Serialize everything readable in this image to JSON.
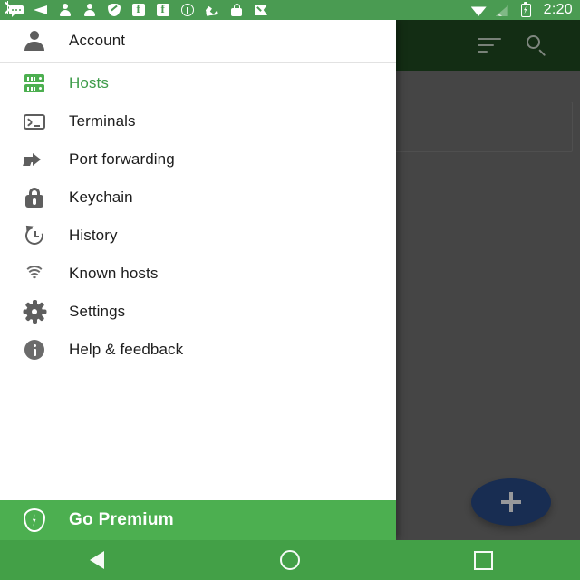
{
  "status_bar": {
    "time": "2:20",
    "left_icons": [
      {
        "name": "chat-bubble-icon",
        "glyph": "chat"
      },
      {
        "name": "send-arrow-icon",
        "glyph": "send"
      },
      {
        "name": "person-icon-1",
        "glyph": "person"
      },
      {
        "name": "person-icon-2",
        "glyph": "person"
      },
      {
        "name": "shield-icon",
        "glyph": "shield"
      },
      {
        "name": "facebook-icon-1",
        "glyph": "fb"
      },
      {
        "name": "facebook-icon-2",
        "glyph": "fb"
      },
      {
        "name": "info-circle-icon",
        "glyph": "info"
      },
      {
        "name": "satellite-icon",
        "glyph": "sat"
      },
      {
        "name": "padlock-icon",
        "glyph": "padlock"
      },
      {
        "name": "check-flag-icon",
        "glyph": "flag"
      }
    ],
    "right_icons": [
      {
        "name": "bluetooth-icon",
        "glyph": "bt"
      },
      {
        "name": "wifi-icon",
        "glyph": "wifi"
      },
      {
        "name": "cellular-signal-off-icon",
        "glyph": "signal"
      },
      {
        "name": "battery-charging-icon",
        "glyph": "batt"
      }
    ]
  },
  "app_bar": {
    "sort_icon": "sort-icon",
    "search_icon": "search-icon"
  },
  "drawer": {
    "header": {
      "label": "Account",
      "icon": "person-icon"
    },
    "items": [
      {
        "label": "Hosts",
        "icon": "server-icon",
        "selected": true
      },
      {
        "label": "Terminals",
        "icon": "terminal-icon",
        "selected": false
      },
      {
        "label": "Port forwarding",
        "icon": "port-forwarding-icon",
        "selected": false
      },
      {
        "label": "Keychain",
        "icon": "lock-icon",
        "selected": false
      },
      {
        "label": "History",
        "icon": "history-clock-icon",
        "selected": false
      },
      {
        "label": "Known hosts",
        "icon": "fingerprint-icon",
        "selected": false
      },
      {
        "label": "Settings",
        "icon": "gear-icon",
        "selected": false
      },
      {
        "label": "Help & feedback",
        "icon": "info-icon",
        "selected": false
      }
    ],
    "footer": {
      "label": "Go Premium",
      "icon": "shield-bolt-icon"
    }
  },
  "fab": {
    "icon": "plus-icon"
  },
  "nav_bar": {
    "back": "back-triangle-icon",
    "home": "home-circle-icon",
    "recents": "recents-square-icon"
  },
  "colors": {
    "status_bar_green": "#4a9b52",
    "app_bar_green": "#1e4620",
    "accent_green": "#3e9c4a",
    "premium_green": "#4CAF50",
    "nav_bar_green": "#43a047",
    "fab_blue": "#25457e",
    "scrim": "#6a6a6a"
  }
}
